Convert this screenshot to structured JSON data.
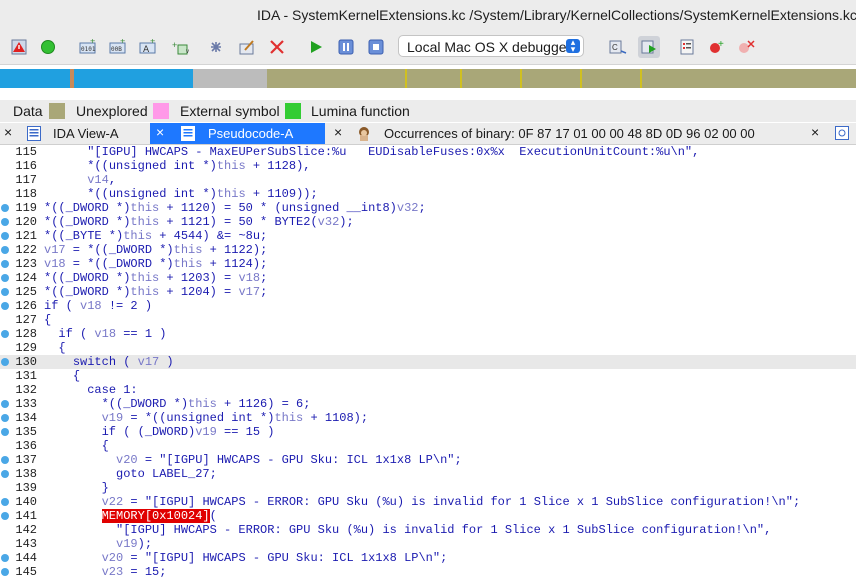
{
  "window": {
    "title": "IDA - SystemKernelExtensions.kc /System/Library/KernelCollections/SystemKernelExtensions.kc"
  },
  "toolbar": {
    "debugger_select": "Local Mac OS X debugger",
    "icons": [
      "warning-icon",
      "green-run-icon",
      "hex-data-icon",
      "binary-data-icon",
      "ascii-data-icon",
      "struct-icon",
      "pointer-icon",
      "edit-icon",
      "delete-icon",
      "play-icon",
      "pause-icon",
      "stop-icon",
      "trace-icon",
      "step-icon",
      "breakpoint-list-icon",
      "add-breakpoint-icon",
      "remove-breakpoint-icon"
    ]
  },
  "colors": {
    "code": "#1b1bb0",
    "variable": "#7878c8",
    "navblue": "#20a0e0",
    "unexplored": "#a9a778",
    "external": "#ff99e8",
    "lumina": "#33cc33",
    "tab_active": "#1e78ff",
    "mem_bg": "#e00000"
  },
  "legend": {
    "data": "Data",
    "unexplored": "Unexplored",
    "external": "External symbol",
    "lumina": "Lumina function"
  },
  "tabs": {
    "ida_view": {
      "label": "IDA View-A",
      "close": "×"
    },
    "pseudocode": {
      "label": "Pseudocode-A",
      "close": "×"
    },
    "occurrences": {
      "label": "Occurrences of binary: 0F 87 17 01 00 00 48 8D 0D 96 02 00 00",
      "close": "×"
    }
  },
  "code_lines": [
    {
      "num": "115",
      "dot": false,
      "hl": false,
      "indent": "      ",
      "tokens": [
        [
          "s",
          "\"[IGPU] HWCAPS - MaxEUPerSubSlice:%u   EUDisableFuses:0x%x  ExecutionUnitCount:%u\\n\","
        ]
      ]
    },
    {
      "num": "116",
      "dot": false,
      "hl": false,
      "indent": "      ",
      "tokens": [
        [
          "c",
          "*((unsigned int *)"
        ],
        [
          "v",
          "this"
        ],
        [
          "c",
          " + 1128),"
        ]
      ]
    },
    {
      "num": "117",
      "dot": false,
      "hl": false,
      "indent": "      ",
      "tokens": [
        [
          "v",
          "v14"
        ],
        [
          "c",
          ","
        ]
      ]
    },
    {
      "num": "118",
      "dot": false,
      "hl": false,
      "indent": "      ",
      "tokens": [
        [
          "c",
          "*((unsigned int *)"
        ],
        [
          "v",
          "this"
        ],
        [
          "c",
          " + 1109));"
        ]
      ]
    },
    {
      "num": "119",
      "dot": true,
      "hl": false,
      "indent": "",
      "tokens": [
        [
          "c",
          "*((_DWORD *)"
        ],
        [
          "v",
          "this"
        ],
        [
          "c",
          " + 1120) = 50 * (unsigned __int8)"
        ],
        [
          "v",
          "v32"
        ],
        [
          "c",
          ";"
        ]
      ]
    },
    {
      "num": "120",
      "dot": true,
      "hl": false,
      "indent": "",
      "tokens": [
        [
          "c",
          "*((_DWORD *)"
        ],
        [
          "v",
          "this"
        ],
        [
          "c",
          " + 1121) = 50 * BYTE2("
        ],
        [
          "v",
          "v32"
        ],
        [
          "c",
          ");"
        ]
      ]
    },
    {
      "num": "121",
      "dot": true,
      "hl": false,
      "indent": "",
      "tokens": [
        [
          "c",
          "*((_BYTE *)"
        ],
        [
          "v",
          "this"
        ],
        [
          "c",
          " + 4544) &= ~8u;"
        ]
      ]
    },
    {
      "num": "122",
      "dot": true,
      "hl": false,
      "indent": "",
      "tokens": [
        [
          "v",
          "v17"
        ],
        [
          "c",
          " = *((_DWORD *)"
        ],
        [
          "v",
          "this"
        ],
        [
          "c",
          " + 1122);"
        ]
      ]
    },
    {
      "num": "123",
      "dot": true,
      "hl": false,
      "indent": "",
      "tokens": [
        [
          "v",
          "v18"
        ],
        [
          "c",
          " = *((_DWORD *)"
        ],
        [
          "v",
          "this"
        ],
        [
          "c",
          " + 1124);"
        ]
      ]
    },
    {
      "num": "124",
      "dot": true,
      "hl": false,
      "indent": "",
      "tokens": [
        [
          "c",
          "*((_DWORD *)"
        ],
        [
          "v",
          "this"
        ],
        [
          "c",
          " + 1203) = "
        ],
        [
          "v",
          "v18"
        ],
        [
          "c",
          ";"
        ]
      ]
    },
    {
      "num": "125",
      "dot": true,
      "hl": false,
      "indent": "",
      "tokens": [
        [
          "c",
          "*((_DWORD *)"
        ],
        [
          "v",
          "this"
        ],
        [
          "c",
          " + 1204) = "
        ],
        [
          "v",
          "v17"
        ],
        [
          "c",
          ";"
        ]
      ]
    },
    {
      "num": "126",
      "dot": true,
      "hl": false,
      "indent": "",
      "tokens": [
        [
          "c",
          "if ( "
        ],
        [
          "v",
          "v18"
        ],
        [
          "c",
          " != 2 )"
        ]
      ]
    },
    {
      "num": "127",
      "dot": false,
      "hl": false,
      "indent": "",
      "tokens": [
        [
          "c",
          "{"
        ]
      ]
    },
    {
      "num": "128",
      "dot": true,
      "hl": false,
      "indent": "  ",
      "tokens": [
        [
          "c",
          "if ( "
        ],
        [
          "v",
          "v18"
        ],
        [
          "c",
          " == 1 )"
        ]
      ]
    },
    {
      "num": "129",
      "dot": false,
      "hl": false,
      "indent": "  ",
      "tokens": [
        [
          "c",
          "{"
        ]
      ]
    },
    {
      "num": "130",
      "dot": true,
      "hl": true,
      "indent": "    ",
      "tokens": [
        [
          "c",
          "switch ( "
        ],
        [
          "v",
          "v17"
        ],
        [
          "c",
          " )"
        ]
      ]
    },
    {
      "num": "131",
      "dot": false,
      "hl": false,
      "indent": "    ",
      "tokens": [
        [
          "c",
          "{"
        ]
      ]
    },
    {
      "num": "132",
      "dot": false,
      "hl": false,
      "indent": "      ",
      "tokens": [
        [
          "c",
          "case 1:"
        ]
      ]
    },
    {
      "num": "133",
      "dot": true,
      "hl": false,
      "indent": "        ",
      "tokens": [
        [
          "c",
          "*((_DWORD *)"
        ],
        [
          "v",
          "this"
        ],
        [
          "c",
          " + 1126) = 6;"
        ]
      ]
    },
    {
      "num": "134",
      "dot": true,
      "hl": false,
      "indent": "        ",
      "tokens": [
        [
          "v",
          "v19"
        ],
        [
          "c",
          " = *((unsigned int *)"
        ],
        [
          "v",
          "this"
        ],
        [
          "c",
          " + 1108);"
        ]
      ]
    },
    {
      "num": "135",
      "dot": true,
      "hl": false,
      "indent": "        ",
      "tokens": [
        [
          "c",
          "if ( (_DWORD)"
        ],
        [
          "v",
          "v19"
        ],
        [
          "c",
          " == 15 )"
        ]
      ]
    },
    {
      "num": "136",
      "dot": false,
      "hl": false,
      "indent": "        ",
      "tokens": [
        [
          "c",
          "{"
        ]
      ]
    },
    {
      "num": "137",
      "dot": true,
      "hl": false,
      "indent": "          ",
      "tokens": [
        [
          "v",
          "v20"
        ],
        [
          "c",
          " = "
        ],
        [
          "s",
          "\"[IGPU] HWCAPS - GPU Sku: ICL 1x1x8 LP\\n\""
        ],
        [
          "c",
          ";"
        ]
      ]
    },
    {
      "num": "138",
      "dot": true,
      "hl": false,
      "indent": "          ",
      "tokens": [
        [
          "c",
          "goto LABEL_27;"
        ]
      ]
    },
    {
      "num": "139",
      "dot": false,
      "hl": false,
      "indent": "        ",
      "tokens": [
        [
          "c",
          "}"
        ]
      ]
    },
    {
      "num": "140",
      "dot": true,
      "hl": false,
      "indent": "        ",
      "tokens": [
        [
          "v",
          "v22"
        ],
        [
          "c",
          " = "
        ],
        [
          "s",
          "\"[IGPU] HWCAPS - ERROR: GPU Sku (%u) is invalid for 1 Slice x 1 SubSlice configuration!\\n\""
        ],
        [
          "c",
          ";"
        ]
      ]
    },
    {
      "num": "141",
      "dot": true,
      "hl": false,
      "indent": "        ",
      "tokens": [
        [
          "m",
          "MEMORY[0x10024]"
        ],
        [
          "c",
          "("
        ]
      ]
    },
    {
      "num": "142",
      "dot": false,
      "hl": false,
      "indent": "          ",
      "tokens": [
        [
          "s",
          "\"[IGPU] HWCAPS - ERROR: GPU Sku (%u) is invalid for 1 Slice x 1 SubSlice configuration!\\n\","
        ]
      ]
    },
    {
      "num": "143",
      "dot": false,
      "hl": false,
      "indent": "          ",
      "tokens": [
        [
          "v",
          "v19"
        ],
        [
          "c",
          ");"
        ]
      ]
    },
    {
      "num": "144",
      "dot": true,
      "hl": false,
      "indent": "        ",
      "tokens": [
        [
          "v",
          "v20"
        ],
        [
          "c",
          " = "
        ],
        [
          "s",
          "\"[IGPU] HWCAPS - GPU Sku: ICL 1x1x8 LP\\n\""
        ],
        [
          "c",
          ";"
        ]
      ]
    },
    {
      "num": "145",
      "dot": true,
      "hl": false,
      "indent": "        ",
      "tokens": [
        [
          "v",
          "v23"
        ],
        [
          "c",
          " = 15;"
        ]
      ]
    }
  ]
}
